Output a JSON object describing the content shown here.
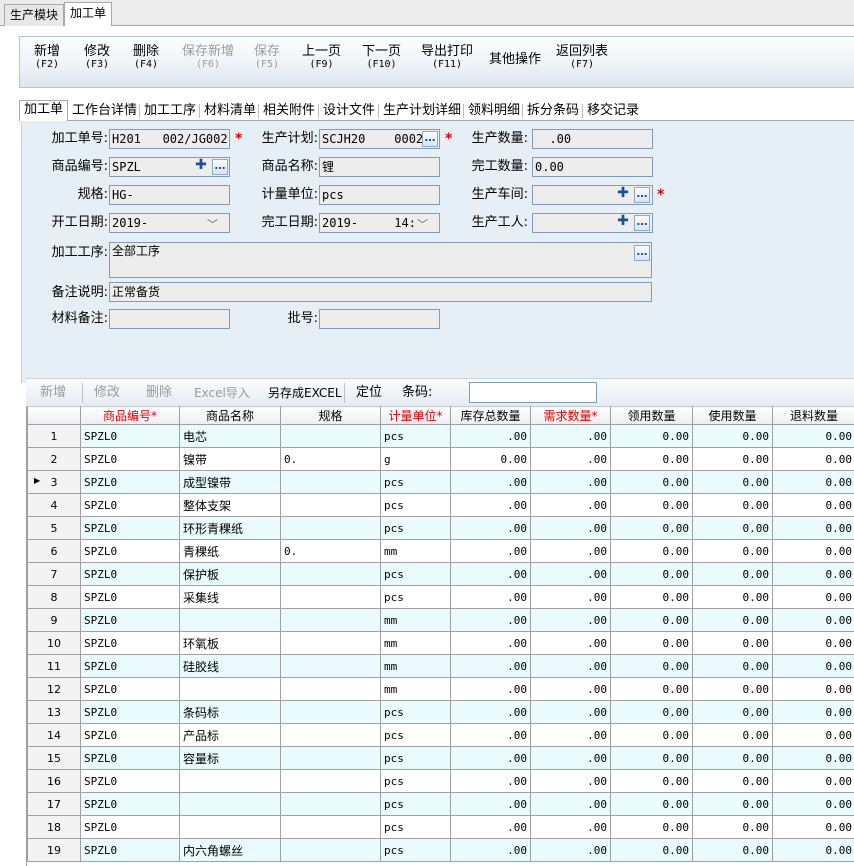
{
  "top_tabs": [
    {
      "label": "生产模块",
      "active": false
    },
    {
      "label": "加工单",
      "active": true
    }
  ],
  "toolbar": {
    "buttons": [
      {
        "label": "新增",
        "key": "(F2)",
        "enabled": true
      },
      {
        "label": "修改",
        "key": "(F3)",
        "enabled": true
      },
      {
        "label": "删除",
        "key": "(F4)",
        "enabled": true
      },
      {
        "label": "保存新增",
        "key": "(F6)",
        "enabled": false
      },
      {
        "label": "保存",
        "key": "(F5)",
        "enabled": false
      },
      {
        "label": "上一页",
        "key": "(F9)",
        "enabled": true
      },
      {
        "label": "下一页",
        "key": "(F10)",
        "enabled": true
      },
      {
        "label": "导出打印",
        "key": "(F11)",
        "enabled": true
      },
      {
        "label": "其他操作",
        "key": "",
        "enabled": true
      },
      {
        "label": "返回列表",
        "key": "(F7)",
        "enabled": true
      }
    ]
  },
  "sub_tabs": [
    "加工单",
    "工作台详情",
    "加工工序",
    "材料清单",
    "相关附件",
    "设计文件",
    "生产计划详细",
    "领料明细",
    "拆分条码",
    "移交记录"
  ],
  "form": {
    "order_no": {
      "label": "加工单号:",
      "value": "H201   002/JG002"
    },
    "plan": {
      "label": "生产计划:",
      "value": "SCJH20    0002"
    },
    "qty": {
      "label": "生产数量:",
      "value": "  .00"
    },
    "product_code": {
      "label": "商品编号:",
      "value": "SPZL    "
    },
    "product_name": {
      "label": "商品名称:",
      "value": "锂"
    },
    "done_qty": {
      "label": "完工数量:",
      "value": "0.00"
    },
    "spec": {
      "label": "规格:",
      "value": "HG-"
    },
    "unit": {
      "label": "计量单位:",
      "value": "pcs"
    },
    "workshop": {
      "label": "生产车间:",
      "value": ""
    },
    "start_date": {
      "label": "开工日期:",
      "value": "2019-"
    },
    "finish_date": {
      "label": "完工日期:",
      "value": "2019-     14:"
    },
    "worker": {
      "label": "生产工人:",
      "value": ""
    },
    "process": {
      "label": "加工工序:",
      "value": "全部工序"
    },
    "remark": {
      "label": "备注说明:",
      "value": "正常备货"
    },
    "material_remark": {
      "label": "材料备注:",
      "value": ""
    },
    "batch": {
      "label": "批号:",
      "value": ""
    }
  },
  "grid_toolbar": {
    "add": "新增",
    "edit": "修改",
    "delete": "删除",
    "excel_import": "Excel导入",
    "save_excel": "另存成EXCEL",
    "locate": "定位",
    "barcode_label": "条码:"
  },
  "grid": {
    "columns": [
      "",
      "商品编号*",
      "商品名称",
      "规格",
      "计量单位*",
      "库存总数量",
      "需求数量*",
      "领用数量",
      "使用数量",
      "退料数量"
    ],
    "required_columns": [
      1,
      4,
      6
    ],
    "current_row": 3,
    "rows": [
      {
        "no": "1",
        "code": "SPZL0",
        "name": "电芯",
        "spec": "",
        "unit": "pcs",
        "stock": ".00",
        "need": ".00",
        "used_out": "0.00",
        "used": "0.00",
        "returned": "0.00"
      },
      {
        "no": "2",
        "code": "SPZL0",
        "name": "镍带",
        "spec": "0.",
        "unit": "g",
        "stock": "0.00",
        "need": ".00",
        "used_out": "0.00",
        "used": "0.00",
        "returned": "0.00"
      },
      {
        "no": "3",
        "code": "SPZL0",
        "name": "成型镍带",
        "spec": "",
        "unit": "pcs",
        "stock": ".00",
        "need": ".00",
        "used_out": "0.00",
        "used": "0.00",
        "returned": "0.00"
      },
      {
        "no": "4",
        "code": "SPZL0",
        "name": "整体支架",
        "spec": "",
        "unit": "pcs",
        "stock": ".00",
        "need": ".00",
        "used_out": "0.00",
        "used": "0.00",
        "returned": "0.00"
      },
      {
        "no": "5",
        "code": "SPZL0",
        "name": "环形青稞纸",
        "spec": "",
        "unit": "pcs",
        "stock": ".00",
        "need": ".00",
        "used_out": "0.00",
        "used": "0.00",
        "returned": "0.00"
      },
      {
        "no": "6",
        "code": "SPZL0",
        "name": "青稞纸",
        "spec": "0.",
        "unit": "mm",
        "stock": ".00",
        "need": ".00",
        "used_out": "0.00",
        "used": "0.00",
        "returned": "0.00"
      },
      {
        "no": "7",
        "code": "SPZL0",
        "name": "保护板",
        "spec": "",
        "unit": "pcs",
        "stock": ".00",
        "need": ".00",
        "used_out": "0.00",
        "used": "0.00",
        "returned": "0.00"
      },
      {
        "no": "8",
        "code": "SPZL0",
        "name": "采集线",
        "spec": "",
        "unit": "pcs",
        "stock": ".00",
        "need": ".00",
        "used_out": "0.00",
        "used": "0.00",
        "returned": "0.00"
      },
      {
        "no": "9",
        "code": "SPZL0",
        "name": "",
        "spec": "",
        "unit": "mm",
        "stock": ".00",
        "need": ".00",
        "used_out": "0.00",
        "used": "0.00",
        "returned": "0.00"
      },
      {
        "no": "10",
        "code": "SPZL0",
        "name": "环氧板",
        "spec": "",
        "unit": "mm",
        "stock": ".00",
        "need": ".00",
        "used_out": "0.00",
        "used": "0.00",
        "returned": "0.00"
      },
      {
        "no": "11",
        "code": "SPZL0",
        "name": "硅胶线",
        "spec": "",
        "unit": "mm",
        "stock": ".00",
        "need": ".00",
        "used_out": "0.00",
        "used": "0.00",
        "returned": "0.00"
      },
      {
        "no": "12",
        "code": "SPZL0",
        "name": "",
        "spec": "",
        "unit": "mm",
        "stock": ".00",
        "need": ".00",
        "used_out": "0.00",
        "used": "0.00",
        "returned": "0.00"
      },
      {
        "no": "13",
        "code": "SPZL0",
        "name": "条码标",
        "spec": "",
        "unit": "pcs",
        "stock": ".00",
        "need": ".00",
        "used_out": "0.00",
        "used": "0.00",
        "returned": "0.00"
      },
      {
        "no": "14",
        "code": "SPZL0",
        "name": "产品标",
        "spec": "",
        "unit": "pcs",
        "stock": ".00",
        "need": ".00",
        "used_out": "0.00",
        "used": "0.00",
        "returned": "0.00"
      },
      {
        "no": "15",
        "code": "SPZL0",
        "name": "容量标",
        "spec": "",
        "unit": "pcs",
        "stock": ".00",
        "need": ".00",
        "used_out": "0.00",
        "used": "0.00",
        "returned": "0.00"
      },
      {
        "no": "16",
        "code": "SPZL0",
        "name": "",
        "spec": "",
        "unit": "pcs",
        "stock": ".00",
        "need": ".00",
        "used_out": "0.00",
        "used": "0.00",
        "returned": "0.00"
      },
      {
        "no": "17",
        "code": "SPZL0",
        "name": "",
        "spec": "",
        "unit": "pcs",
        "stock": ".00",
        "need": ".00",
        "used_out": "0.00",
        "used": "0.00",
        "returned": "0.00"
      },
      {
        "no": "18",
        "code": "SPZL0",
        "name": "",
        "spec": "",
        "unit": "pcs",
        "stock": ".00",
        "need": ".00",
        "used_out": "0.00",
        "used": "0.00",
        "returned": "0.00"
      },
      {
        "no": "19",
        "code": "SPZL0",
        "name": "内六角螺丝",
        "spec": "",
        "unit": "pcs",
        "stock": ".00",
        "need": ".00",
        "used_out": "0.00",
        "used": "0.00",
        "returned": "0.00"
      }
    ]
  },
  "colors": {
    "required": "#e00000",
    "row_alt": "#e9fbfd",
    "form_bg": "#e6eff5",
    "icon_blue": "#1d4f9a"
  }
}
